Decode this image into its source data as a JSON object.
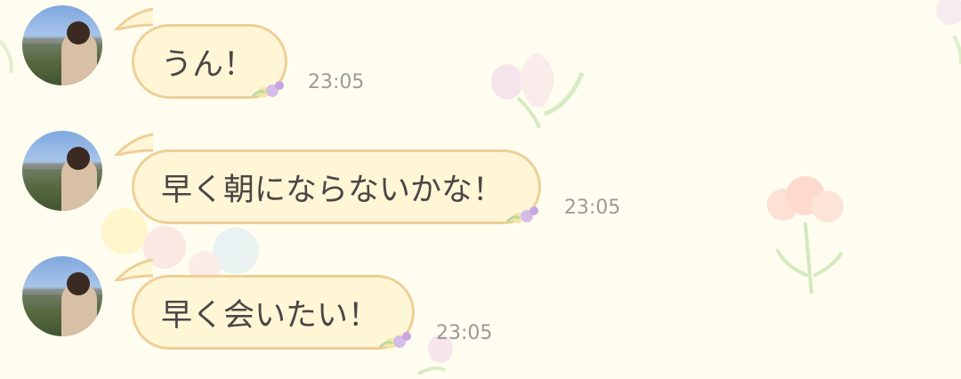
{
  "messages": [
    {
      "text": "うん！",
      "time": "23:05"
    },
    {
      "text": "早く朝にならないかな！",
      "time": "23:05"
    },
    {
      "text": "早く会いたい！",
      "time": "23:05"
    }
  ]
}
